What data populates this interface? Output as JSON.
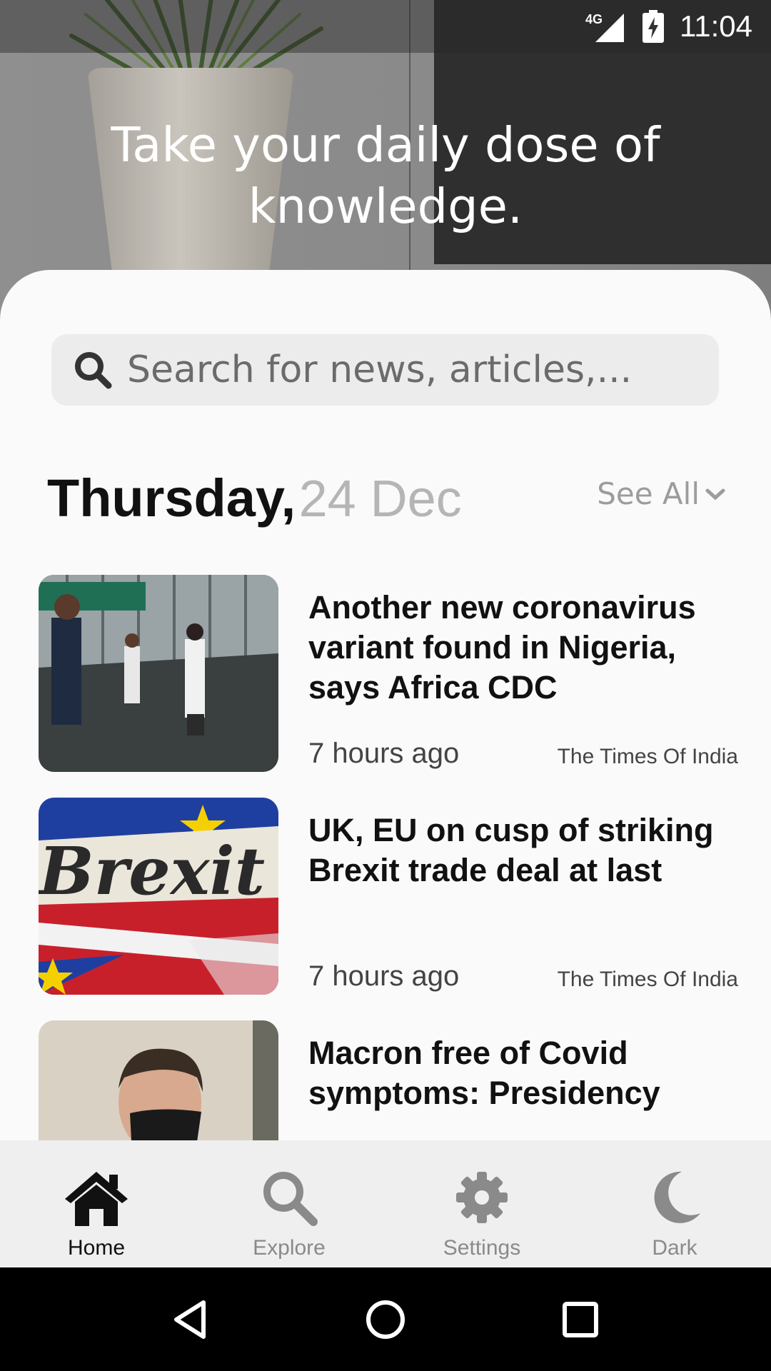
{
  "status_bar": {
    "network": "4G",
    "time": "11:04"
  },
  "hero": {
    "title": "Take your daily dose of knowledge."
  },
  "search": {
    "placeholder": "Search for news, articles,..."
  },
  "date_header": {
    "day": "Thursday,",
    "date": "24 Dec",
    "see_all": "See All"
  },
  "articles": [
    {
      "title": "Another new coronavirus variant found in Nigeria, says Africa CDC",
      "time": "7 hours ago",
      "source": "The Times Of India"
    },
    {
      "title": "UK, EU on cusp of striking Brexit trade deal at last",
      "time": "7 hours ago",
      "source": "The Times Of India",
      "image_text": "Brexit"
    },
    {
      "title": "Macron free of Covid symptoms: Presidency",
      "time": "",
      "source": ""
    }
  ],
  "bottom_nav": [
    {
      "label": "Home",
      "icon": "home-icon",
      "active": true
    },
    {
      "label": "Explore",
      "icon": "search-icon",
      "active": false
    },
    {
      "label": "Settings",
      "icon": "gear-icon",
      "active": false
    },
    {
      "label": "Dark",
      "icon": "moon-icon",
      "active": false
    }
  ],
  "colors": {
    "accent": "#111111",
    "inactive": "#8a8a8a",
    "sheet": "#fafafa",
    "nav_bg": "#efefef"
  }
}
